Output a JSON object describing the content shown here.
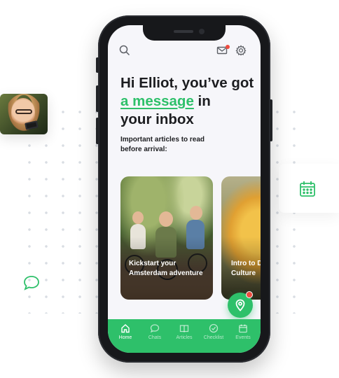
{
  "colors": {
    "accent": "#2ec06a",
    "notification": "#ee4b3f",
    "text": "#1c1d20"
  },
  "header": {
    "search_icon": "search-icon",
    "mail_icon": "mail-icon",
    "settings_icon": "gear-icon"
  },
  "greeting": {
    "line1": "Hi Elliot, you’ve got",
    "link": "a message",
    "line2_rest": " in",
    "line3": "your inbox"
  },
  "subtitle": "Important articles to read before arrival:",
  "articles": [
    {
      "title": "Kickstart your Amsterdam adventure"
    },
    {
      "title": "Intro to D Culture"
    }
  ],
  "fab": {
    "icon": "map-pin-icon"
  },
  "tabs": [
    {
      "label": "Home",
      "icon": "home-icon",
      "active": true
    },
    {
      "label": "Chats",
      "icon": "chat-icon",
      "active": false
    },
    {
      "label": "Articles",
      "icon": "book-icon",
      "active": false
    },
    {
      "label": "Checklist",
      "icon": "check-circle-icon",
      "active": false
    },
    {
      "label": "Events",
      "icon": "calendar-icon",
      "active": false
    }
  ],
  "floating": {
    "calendar_icon": "calendar-icon",
    "chat_icon": "chat-bubble-icon"
  }
}
